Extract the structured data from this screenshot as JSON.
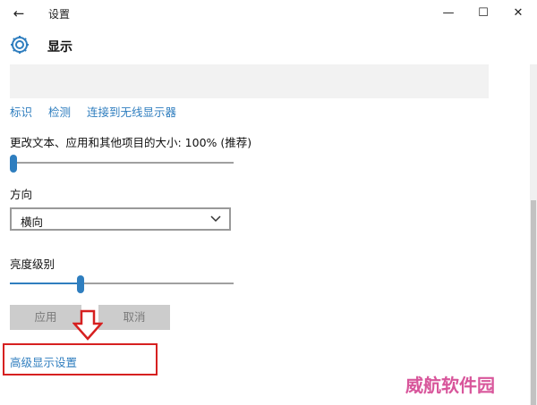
{
  "window": {
    "back_icon": "back-arrow-icon",
    "title": "设置",
    "minimize_icon": "minimize-icon",
    "maximize_icon": "maximize-icon",
    "close_icon": "close-icon"
  },
  "header": {
    "icon": "gear-icon",
    "title": "显示"
  },
  "links": [
    "标识",
    "检测",
    "连接到无线显示器"
  ],
  "scale": {
    "label": "更改文本、应用和其他项目的大小: 100% (推荐)",
    "slider_fraction": 0.0
  },
  "orientation": {
    "label": "方向",
    "selected": "横向"
  },
  "brightness": {
    "label": "亮度级别",
    "slider_fraction": 0.31
  },
  "buttons": {
    "apply": "应用",
    "cancel": "取消"
  },
  "advanced_link": "高级显示设置",
  "watermark": "威航软件园",
  "colors": {
    "accent": "#2f7ebf",
    "annotation": "#d62020"
  }
}
